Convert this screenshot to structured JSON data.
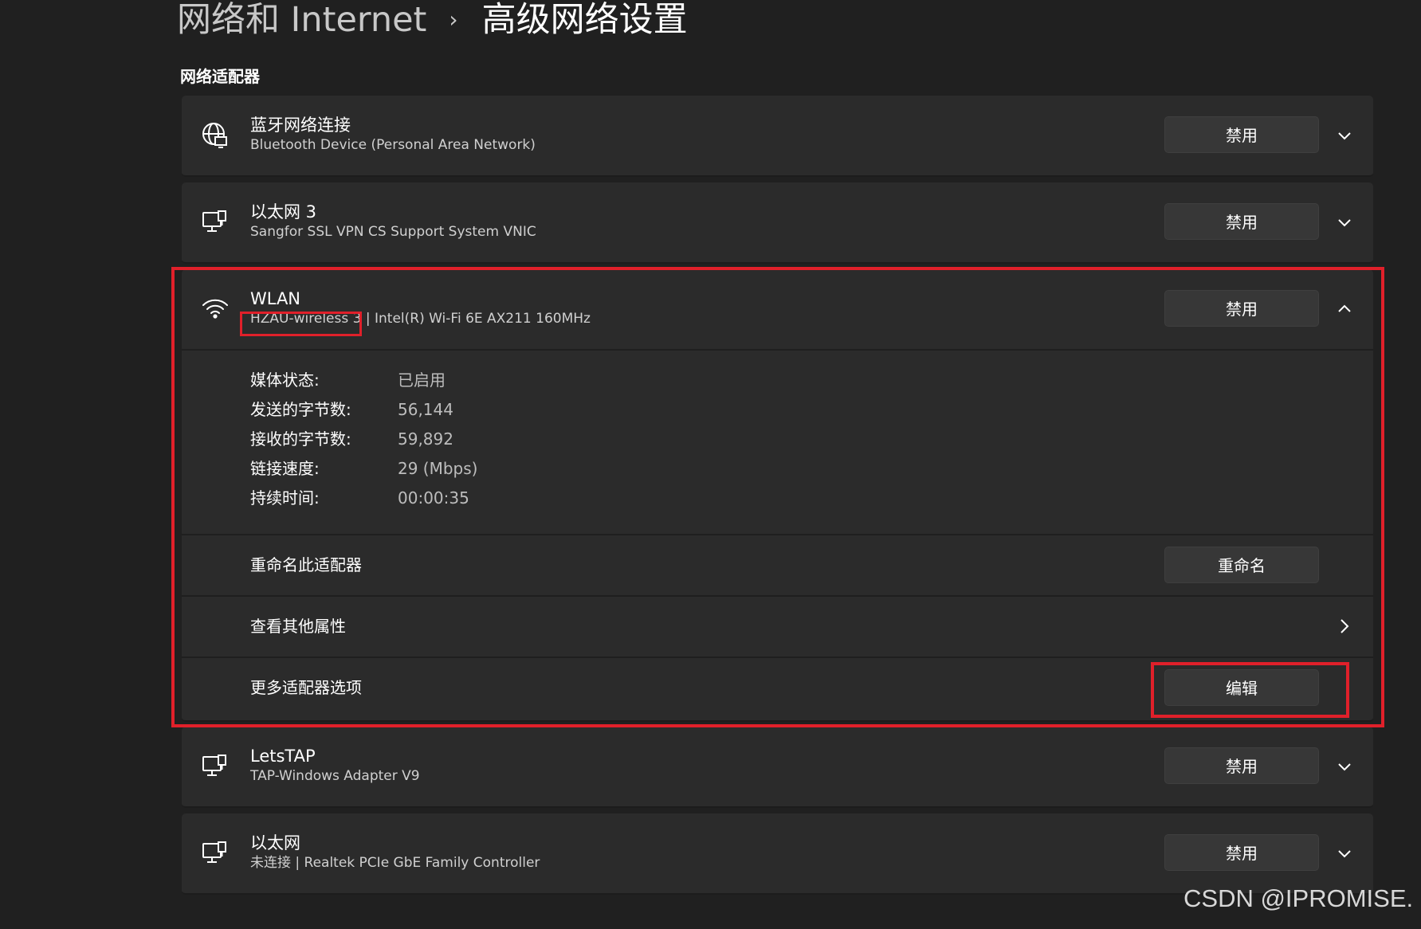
{
  "header": {
    "parent": "网络和 Internet",
    "separator": "›",
    "current": "高级网络设置"
  },
  "section_title": "网络适配器",
  "adapters": [
    {
      "name": "蓝牙网络连接",
      "desc": "Bluetooth Device (Personal Area Network)",
      "button": "禁用",
      "icon": "globe-network-icon",
      "chevron": "chevron-down-icon"
    },
    {
      "name": "以太网 3",
      "desc": "Sangfor SSL VPN CS Support System VNIC",
      "button": "禁用",
      "icon": "ethernet-icon",
      "chevron": "chevron-down-icon"
    },
    {
      "name": "WLAN",
      "desc_ssid": "HZAU-wireless 3",
      "desc_rest": " | Intel(R) Wi-Fi 6E AX211 160MHz",
      "button": "禁用",
      "icon": "wifi-icon",
      "chevron": "chevron-up-icon"
    },
    {
      "name": "LetsTAP",
      "desc": "TAP-Windows Adapter V9",
      "button": "禁用",
      "icon": "ethernet-icon",
      "chevron": "chevron-down-icon"
    },
    {
      "name": "以太网",
      "desc": "未连接 | Realtek PCIe GbE Family Controller",
      "button": "禁用",
      "icon": "ethernet-icon",
      "chevron": "chevron-down-icon"
    }
  ],
  "wlan_details": [
    {
      "key": "媒体状态:",
      "value": "已启用"
    },
    {
      "key": "发送的字节数:",
      "value": "56,144"
    },
    {
      "key": "接收的字节数:",
      "value": "59,892"
    },
    {
      "key": "链接速度:",
      "value": "29 (Mbps)"
    },
    {
      "key": "持续时间:",
      "value": "00:00:35"
    }
  ],
  "wlan_actions": {
    "rename_label": "重命名此适配器",
    "rename_button": "重命名",
    "more_props_label": "查看其他属性",
    "more_options_label": "更多适配器选项",
    "edit_button": "编辑"
  },
  "watermark": "CSDN @IPROMISE.",
  "colors": {
    "background": "#202020",
    "card": "#2b2b2b",
    "button": "#373737",
    "annotation": "#e0202a"
  }
}
